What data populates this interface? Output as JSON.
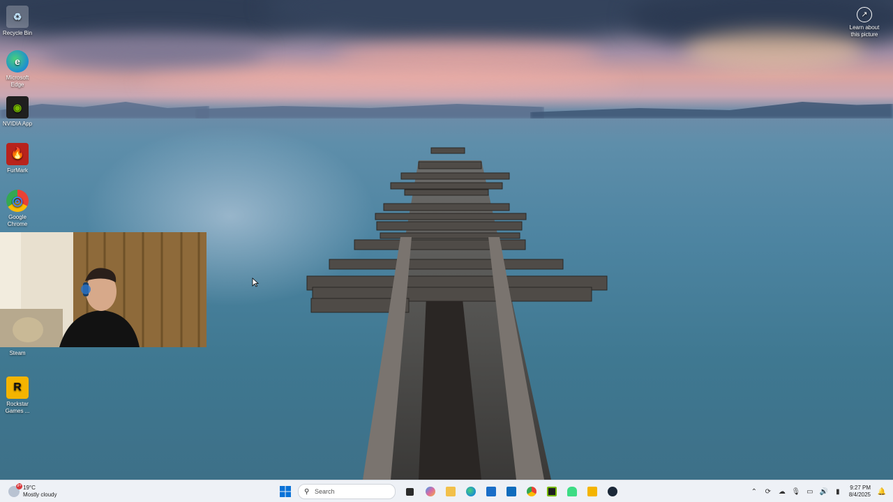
{
  "desktop": {
    "icons": [
      {
        "name": "recycle-bin",
        "label": "Recycle Bin",
        "color": "#7fb2d9",
        "glyph": "♻"
      },
      {
        "name": "microsoft-edge",
        "label": "Microsoft Edge",
        "color": "#1c8ed1",
        "glyph": "e"
      },
      {
        "name": "nvidia-app",
        "label": "NVIDIA App",
        "color": "#1f1f1f",
        "glyph": "◉"
      },
      {
        "name": "furmark",
        "label": "FurMark",
        "color": "#b8231c",
        "glyph": "🔥"
      },
      {
        "name": "google-chrome",
        "label": "Google Chrome",
        "color": "#ffffff",
        "glyph": "◎"
      },
      {
        "name": "steam",
        "label": "Steam",
        "color": "#1b2838",
        "glyph": "⚙"
      },
      {
        "name": "rockstar-games",
        "label": "Rockstar Games ...",
        "color": "#f4b400",
        "glyph": "R"
      }
    ],
    "learn_about": "Learn about this picture"
  },
  "taskbar": {
    "weather": {
      "temp": "19°C",
      "condition": "Mostly cloudy",
      "badge": "9+"
    },
    "search_placeholder": "Search",
    "apps": [
      {
        "name": "start",
        "color": "#0a72d8"
      },
      {
        "name": "task-view",
        "color": "#2b2b2b"
      },
      {
        "name": "copilot",
        "color": "#d96aa3"
      },
      {
        "name": "file-explorer",
        "color": "#f2c04a"
      },
      {
        "name": "edge",
        "color": "#1c8ed1"
      },
      {
        "name": "store",
        "color": "#1a6ec8"
      },
      {
        "name": "outlook",
        "color": "#0f6cbd"
      },
      {
        "name": "chrome",
        "color": "#e94235"
      },
      {
        "name": "nvidia",
        "color": "#76b900"
      },
      {
        "name": "android",
        "color": "#3ddc84"
      },
      {
        "name": "rockstar",
        "color": "#f4b400"
      },
      {
        "name": "steam",
        "color": "#1b2838"
      }
    ],
    "time": "9:27 PM",
    "date": "8/4/2025"
  }
}
